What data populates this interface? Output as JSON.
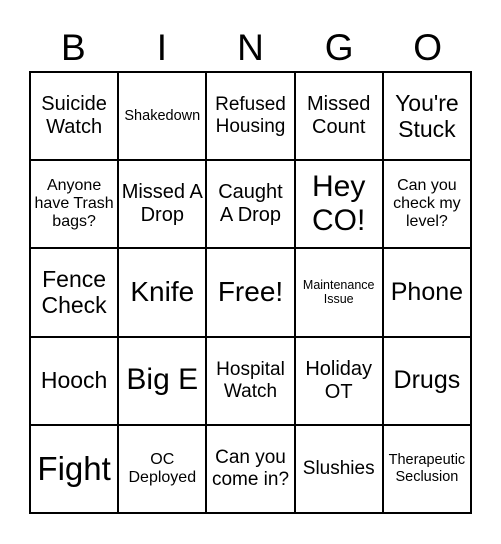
{
  "header": {
    "letters": [
      "B",
      "I",
      "N",
      "G",
      "O"
    ]
  },
  "cells": [
    "Suicide Watch",
    "Shakedown",
    "Refused Housing",
    "Missed Count",
    "You're Stuck",
    "Anyone have Trash bags?",
    "Missed A Drop",
    "Caught A Drop",
    "Hey CO!",
    "Can you check my level?",
    "Fence Check",
    "Knife",
    "Free!",
    "Maintenance Issue",
    "Phone",
    "Hooch",
    "Big E",
    "Hospital Watch",
    "Holiday OT",
    "Drugs",
    "Fight",
    "OC Deployed",
    "Can you come in?",
    "Slushies",
    "Therapeutic Seclusion"
  ]
}
